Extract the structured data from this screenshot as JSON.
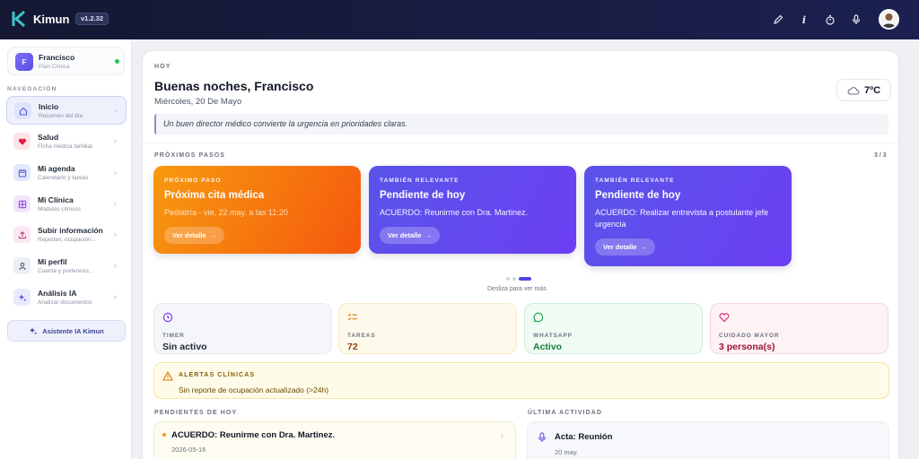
{
  "app": {
    "name": "Kimun",
    "version": "v1.2.32",
    "top_icons": [
      "pencil-icon",
      "info-icon",
      "timer-icon",
      "microphone-icon",
      "avatar"
    ]
  },
  "sidebar": {
    "user": {
      "initial": "F",
      "name": "Francisco",
      "plan": "Plan Clínica",
      "status_color": "#22c55e"
    },
    "nav_title": "NAVEGACIÓN",
    "items": [
      {
        "label": "Inicio",
        "sub": "Resumen del día",
        "icon": "home-icon",
        "active": true
      },
      {
        "label": "Salud",
        "sub": "Ficha médica familiar",
        "icon": "heart-icon"
      },
      {
        "label": "Mi agenda",
        "sub": "Calendario y tareas",
        "icon": "calendar-icon"
      },
      {
        "label": "Mi Clínica",
        "sub": "Módulos clínicos",
        "icon": "grid-icon"
      },
      {
        "label": "Subir información",
        "sub": "Reportes, ocupación...",
        "icon": "upload-icon"
      },
      {
        "label": "Mi perfil",
        "sub": "Cuenta y preferenci...",
        "icon": "user-icon"
      },
      {
        "label": "Análisis IA",
        "sub": "Analizar documentos",
        "icon": "sparkle-icon"
      }
    ],
    "assistant_label": "Asistente IA Kimun"
  },
  "main": {
    "section_today": "HOY",
    "greeting": "Buenas noches, Francisco",
    "date": "Miércoles, 20 De Mayo",
    "weather": {
      "temp": "7ºC",
      "icon": "cloud-icon"
    },
    "quote": "Un buen director médico convierte la urgencia en prioridades claras.",
    "next_steps_label": "PRÓXIMOS PASOS",
    "next_steps_counter": "3 / 3",
    "steps": [
      {
        "kicker": "PRÓXIMO PASO",
        "title": "Próxima cita médica",
        "desc": "Pediatría - vie, 22 may. a las 11:20",
        "button": "Ver detalle"
      },
      {
        "kicker": "TAMBIÉN RELEVANTE",
        "title": "Pendiente de hoy",
        "desc": "ACUERDO: Reunirme con Dra. Martinez.",
        "button": "Ver detalle"
      },
      {
        "kicker": "TAMBIÉN RELEVANTE",
        "title": "Pendiente de hoy",
        "desc": "ACUERDO: Realizar entrevista a postulante jefe urgencia",
        "button": "Ver detalle"
      }
    ],
    "swipe_hint": "Desliza para ver más",
    "stats": [
      {
        "label": "TIMER",
        "value": "Sin activo",
        "icon": "clock-icon",
        "color": "#7c3aed",
        "bg": "#f5f6f9",
        "border": "#e8eaef",
        "value_color": "#1f2937"
      },
      {
        "label": "TAREAS",
        "value": "72",
        "icon": "checklist-icon",
        "color": "#d97706",
        "bg": "#fefaeb",
        "border": "#f5ebc4",
        "value_color": "#92400e"
      },
      {
        "label": "WHATSAPP",
        "value": "Activo",
        "icon": "chat-icon",
        "color": "#16a34a",
        "bg": "#effbf3",
        "border": "#cdeed8",
        "value_color": "#15803d"
      },
      {
        "label": "CUIDADO MAYOR",
        "value": "3 persona(s)",
        "icon": "heart-outline-icon",
        "color": "#db2777",
        "bg": "#fdf2f4",
        "border": "#f7d5dc",
        "value_color": "#9f1239"
      }
    ],
    "alert": {
      "title": "ALERTAS CLÍNICAS",
      "text": "Sin reporte de ocupación actualizado (>24h)"
    },
    "pending_label": "PENDIENTES DE HOY",
    "pending": {
      "title": "ACUERDO: Reunirme con Dra. Martinez.",
      "date": "2026-05-16"
    },
    "activity_label": "ÚLTIMA ACTIVIDAD",
    "activity": {
      "title": "Acta: Reunión",
      "date": "20 may."
    }
  }
}
